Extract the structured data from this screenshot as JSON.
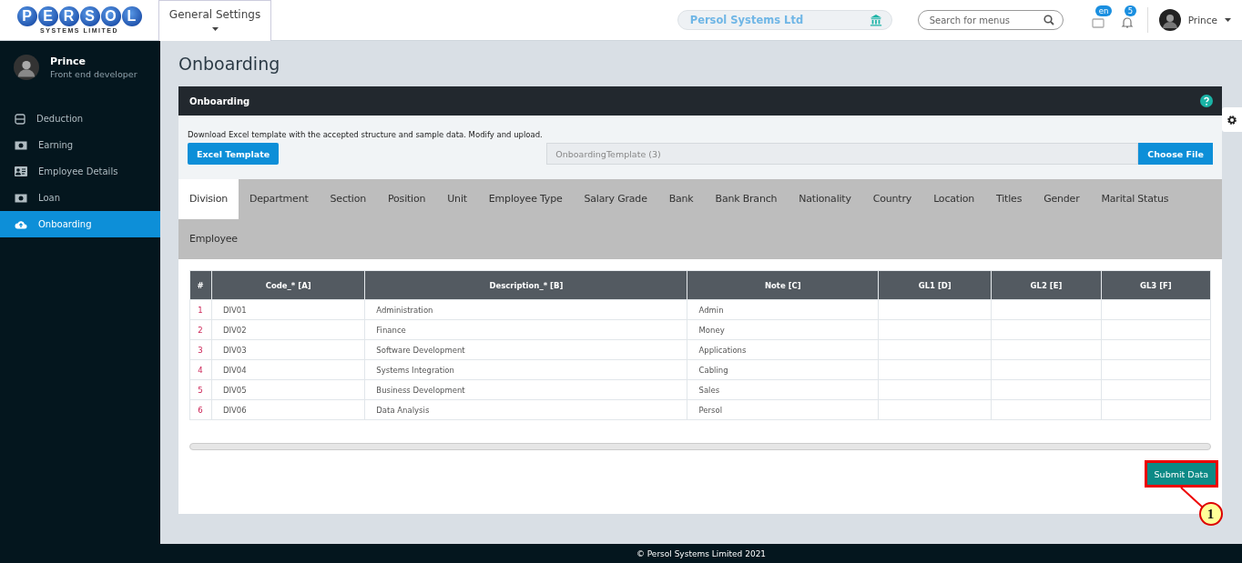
{
  "logo": {
    "letters": [
      "P",
      "E",
      "R",
      "S",
      "O",
      "L"
    ],
    "tagline": "SYSTEMS LIMITED"
  },
  "topbar": {
    "menu": "General Settings",
    "company": "Persol Systems Ltd",
    "search": {
      "placeholder": "Search for menus"
    },
    "language_badge": "en",
    "notification_count": "5",
    "user": "Prince"
  },
  "sidebar": {
    "profile": {
      "name": "Prince",
      "role": "Front end developer"
    },
    "items": [
      {
        "label": "Deduction",
        "selected": false
      },
      {
        "label": "Earning",
        "selected": false
      },
      {
        "label": "Employee Details",
        "selected": false
      },
      {
        "label": "Loan",
        "selected": false
      },
      {
        "label": "Onboarding",
        "selected": true
      }
    ]
  },
  "page_title": "Onboarding",
  "card": {
    "title": "Onboarding",
    "instructions": "Download Excel template with the accepted structure and sample data. Modify and upload.",
    "template_button": "Excel Template",
    "file_name": "OnboardingTemplate (3)",
    "choose_button": "Choose File",
    "tabs": [
      {
        "label": "Division",
        "selected": true
      },
      {
        "label": "Department",
        "selected": false
      },
      {
        "label": "Section",
        "selected": false
      },
      {
        "label": "Position",
        "selected": false
      },
      {
        "label": "Unit",
        "selected": false
      },
      {
        "label": "Employee Type",
        "selected": false
      },
      {
        "label": "Salary Grade",
        "selected": false
      },
      {
        "label": "Bank",
        "selected": false
      },
      {
        "label": "Bank Branch",
        "selected": false
      },
      {
        "label": "Nationality",
        "selected": false
      },
      {
        "label": "Country",
        "selected": false
      },
      {
        "label": "Location",
        "selected": false
      },
      {
        "label": "Titles",
        "selected": false
      },
      {
        "label": "Gender",
        "selected": false
      },
      {
        "label": "Marital Status",
        "selected": false
      },
      {
        "label": "Employee",
        "selected": false
      }
    ],
    "table": {
      "columns": [
        "#",
        "Code_* [A]",
        "Description_* [B]",
        "Note [C]",
        "GL1 [D]",
        "GL2 [E]",
        "GL3 [F]"
      ],
      "rows": [
        [
          "1",
          "DIV01",
          "Administration",
          "Admin",
          "",
          "",
          ""
        ],
        [
          "2",
          "DIV02",
          "Finance",
          "Money",
          "",
          "",
          ""
        ],
        [
          "3",
          "DIV03",
          "Software Development",
          "Applications",
          "",
          "",
          ""
        ],
        [
          "4",
          "DIV04",
          "Systems Integration",
          "Cabling",
          "",
          "",
          ""
        ],
        [
          "5",
          "DIV05",
          "Business Development",
          "Sales",
          "",
          "",
          ""
        ],
        [
          "6",
          "DIV06",
          "Data Analysis",
          "Persol",
          "",
          "",
          ""
        ]
      ]
    },
    "submit_button": "Submit Data"
  },
  "callout": {
    "number": "1"
  },
  "footer": "© Persol Systems Limited 2021"
}
